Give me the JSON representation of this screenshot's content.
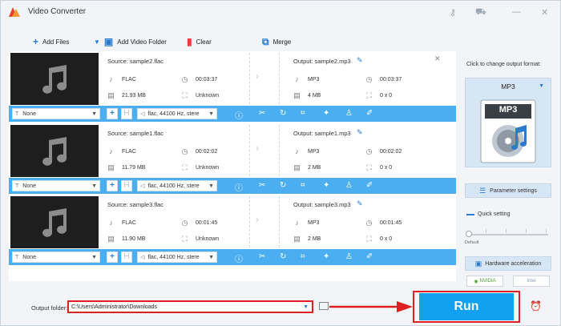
{
  "window": {
    "title": "Video Converter",
    "icons": [
      "key-icon",
      "cart-icon",
      "minimize-icon",
      "close-icon"
    ]
  },
  "toolbar": {
    "add_files": "Add Files",
    "add_video_folder": "Add Video Folder",
    "clear": "Clear",
    "merge": "Merge"
  },
  "tasks": [
    {
      "source": "Source: sample2.flac",
      "src_format": "FLAC",
      "src_duration": "00:03:37",
      "src_size": "21.93 MB",
      "src_resolution": "Unknown",
      "output": "Output: sample2.mp3",
      "out_format": "MP3",
      "out_duration": "00:03:37",
      "out_size": "4 MB",
      "out_resolution": "0 x 0",
      "subtitle": "None",
      "audio": "flac, 44100 Hz, stere"
    },
    {
      "source": "Source: sample1.flac",
      "src_format": "FLAC",
      "src_duration": "00:02:02",
      "src_size": "11.79 MB",
      "src_resolution": "Unknown",
      "output": "Output: sample1.mp3",
      "out_format": "MP3",
      "out_duration": "00:02:02",
      "out_size": "2 MB",
      "out_resolution": "0 x 0",
      "subtitle": "None",
      "audio": "flac, 44100 Hz, stere"
    },
    {
      "source": "Source: sample3.flac",
      "src_format": "FLAC",
      "src_duration": "00:01:45",
      "src_size": "11.90 MB",
      "src_resolution": "Unknown",
      "output": "Output: sample3.mp3",
      "out_format": "MP3",
      "out_duration": "00:01:45",
      "out_size": "2 MB",
      "out_resolution": "0 x 0",
      "subtitle": "None",
      "audio": "flac, 44100 Hz, stere"
    }
  ],
  "side": {
    "prompt": "Click to change output format:",
    "format": "MP3",
    "format_badge": "MP3",
    "parameter_settings": "Parameter settings",
    "quick_setting": "Quick setting",
    "default_label": "Default",
    "hardware_acceleration": "Hardware acceleration",
    "nvidia": "NVIDIA",
    "intel": "Intel"
  },
  "bottom": {
    "output_folder_label": "Output folder:",
    "output_folder_path": "C:\\Users\\Administrator\\Downloads",
    "run": "Run"
  },
  "colors": {
    "accent": "#12a0f0",
    "task_bar": "#4aaef0",
    "highlight": "#e02020"
  }
}
